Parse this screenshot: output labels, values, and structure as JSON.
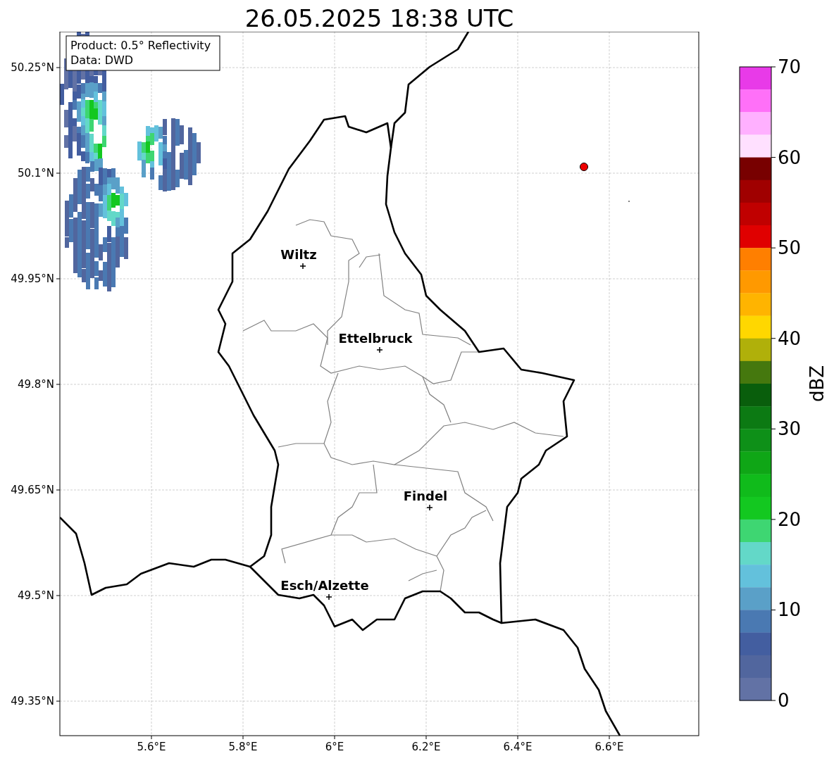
{
  "title": "26.05.2025 18:38 UTC",
  "info_box": {
    "lines": [
      "Product: 0.5° Reflectivity",
      "Data: DWD"
    ]
  },
  "map": {
    "lon_labels": [
      "5.6°E",
      "5.8°E",
      "6°E",
      "6.2°E",
      "6.4°E",
      "6.6°E"
    ],
    "lat_labels": [
      "50.25°N",
      "50.1°N",
      "49.95°N",
      "49.8°N",
      "49.65°N",
      "49.5°N",
      "49.35°N"
    ],
    "cities": [
      {
        "name": "Wiltz"
      },
      {
        "name": "Ettelbruck"
      },
      {
        "name": "Findel"
      },
      {
        "name": "Esch/Alzette"
      }
    ]
  },
  "colorbar": {
    "label": "dBZ",
    "ticks": [
      "70",
      "60",
      "50",
      "40",
      "30",
      "20",
      "10",
      "0"
    ],
    "segments": [
      {
        "color": "#e83ae8"
      },
      {
        "color": "#ff70f8"
      },
      {
        "color": "#ffb0ff"
      },
      {
        "color": "#ffe0ff"
      },
      {
        "color": "#780000"
      },
      {
        "color": "#a00000"
      },
      {
        "color": "#c00000"
      },
      {
        "color": "#e00000"
      },
      {
        "color": "#ff7f00"
      },
      {
        "color": "#ff9900"
      },
      {
        "color": "#ffb400"
      },
      {
        "color": "#ffd700"
      },
      {
        "color": "#b0b00a"
      },
      {
        "color": "#45780e"
      },
      {
        "color": "#095e0c"
      },
      {
        "color": "#0c7a13"
      },
      {
        "color": "#0e9018"
      },
      {
        "color": "#0fa616"
      },
      {
        "color": "#10bb1b"
      },
      {
        "color": "#13c820"
      },
      {
        "color": "#3ed672"
      },
      {
        "color": "#63d8c8"
      },
      {
        "color": "#63c1dc"
      },
      {
        "color": "#5aa0c8"
      },
      {
        "color": "#4a79b2"
      },
      {
        "color": "#435ea0"
      },
      {
        "color": "#51669e"
      },
      {
        "color": "#6272a5"
      }
    ]
  }
}
